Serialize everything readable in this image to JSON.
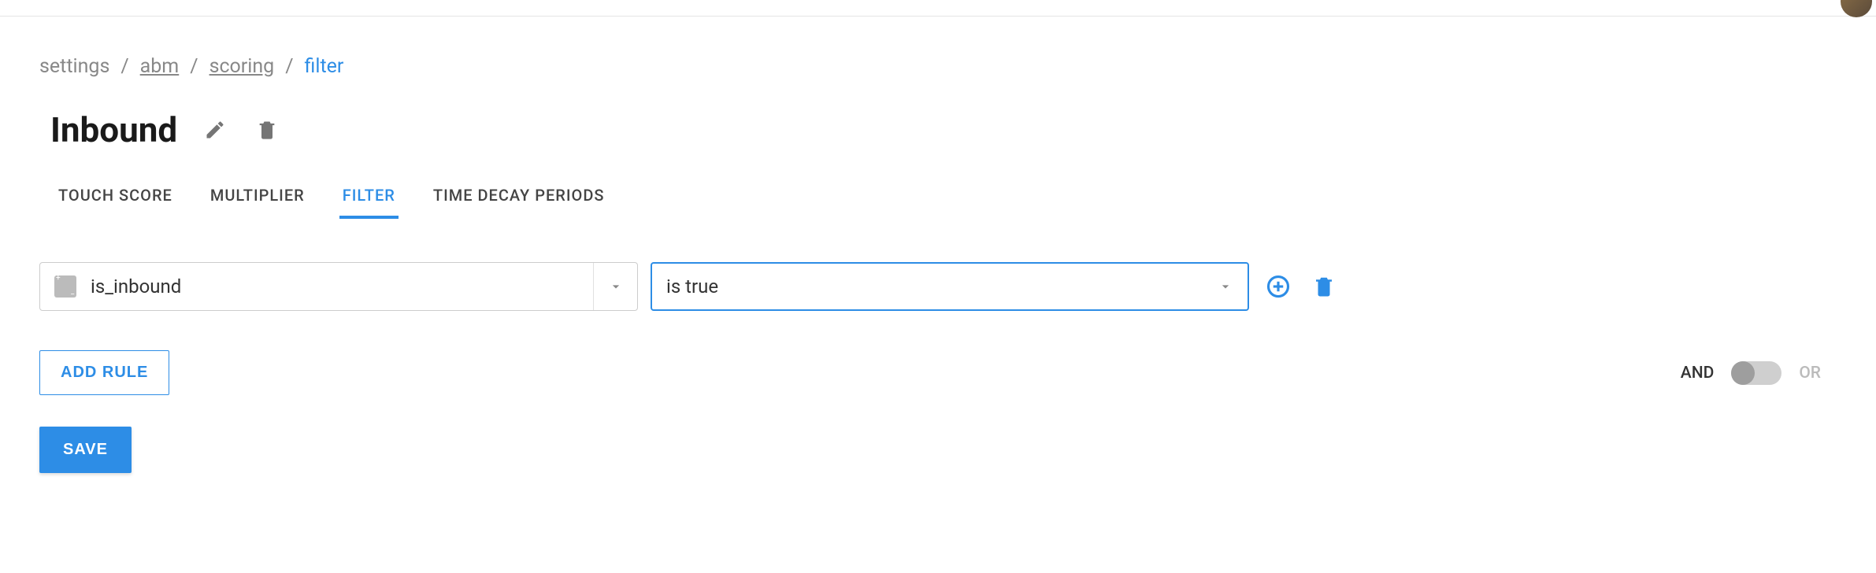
{
  "breadcrumb": {
    "items": [
      {
        "label": "settings",
        "link": false
      },
      {
        "label": "abm",
        "link": true
      },
      {
        "label": "scoring",
        "link": true
      },
      {
        "label": "filter",
        "link": false,
        "current": true
      }
    ]
  },
  "title": "Inbound",
  "tabs": [
    {
      "label": "TOUCH SCORE",
      "active": false
    },
    {
      "label": "MULTIPLIER",
      "active": false
    },
    {
      "label": "FILTER",
      "active": true
    },
    {
      "label": "TIME DECAY PERIODS",
      "active": false
    }
  ],
  "filter": {
    "field_value": "is_inbound",
    "operator_value": "is true"
  },
  "buttons": {
    "add_rule": "ADD RULE",
    "save": "SAVE"
  },
  "logic": {
    "left": "AND",
    "right": "OR",
    "state": "AND"
  }
}
